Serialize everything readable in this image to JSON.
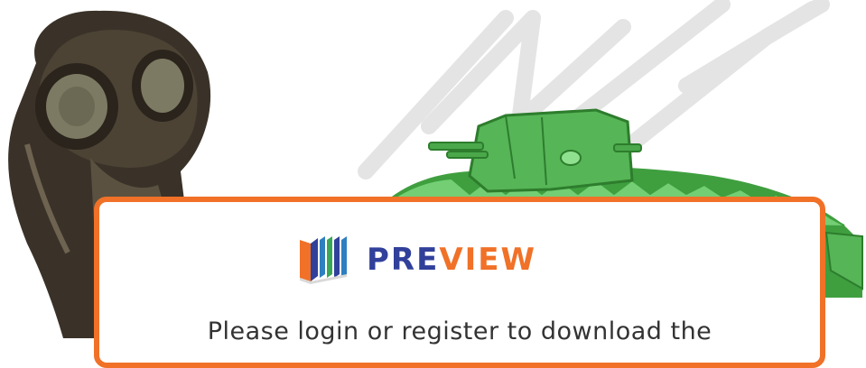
{
  "background": {
    "left_image": "gas-mask",
    "right_image": "tank",
    "watermark": "preview-watermark"
  },
  "dialog": {
    "logo_icon": "book-stack-icon",
    "logo_word_part1": "PRE",
    "logo_word_part2": "VIEW",
    "message": "Please login or register to download the",
    "accent_color": "#f07127",
    "brand_color": "#31409a"
  }
}
